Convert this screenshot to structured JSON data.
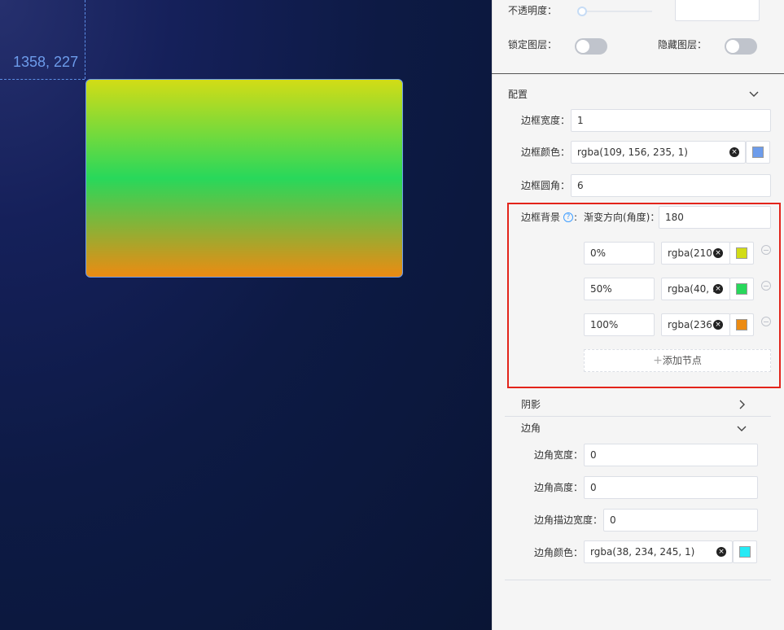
{
  "canvas": {
    "coord_label": "1358, 227"
  },
  "layer": {
    "opacity_label": "不透明度：",
    "lock_label": "锁定图层：",
    "hide_label": "隐藏图层："
  },
  "config": {
    "title": "配置",
    "border_width_label": "边框宽度：",
    "border_width": "1",
    "border_color_label": "边框颜色：",
    "border_color": "rgba(109, 156, 235, 1)",
    "border_color_hex": "#6d9ceb",
    "border_radius_label": "边框圆角：",
    "border_radius": "6",
    "bg_label": "边框背景",
    "gradient_dir_label": "渐变方向(角度)：",
    "gradient_dir": "180",
    "stops": [
      {
        "offset": "0%",
        "color": "rgba(210",
        "hex": "#d2dc16"
      },
      {
        "offset": "50%",
        "color": "rgba(40, .",
        "hex": "#28d85b"
      },
      {
        "offset": "100%",
        "color": "rgba(236",
        "hex": "#ec8b12"
      }
    ],
    "add_stop_label": "添加节点"
  },
  "shadow": {
    "title": "阴影"
  },
  "corner": {
    "title": "边角",
    "width_label": "边角宽度：",
    "width": "0",
    "height_label": "边角高度：",
    "height": "0",
    "stroke_label": "边角描边宽度：",
    "stroke": "0",
    "color_label": "边角颜色：",
    "color": "rgba(38, 234, 245, 1)",
    "color_hex": "#26eaf5"
  }
}
